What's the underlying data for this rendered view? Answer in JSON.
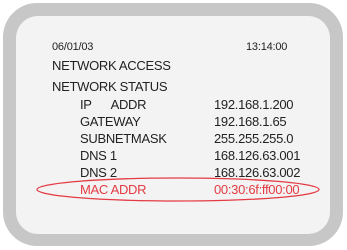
{
  "header": {
    "date": "06/01/03",
    "time": "13:14:00"
  },
  "menu": {
    "items": [
      "NETWORK ACCESS",
      "NETWORK STATUS"
    ]
  },
  "status": {
    "rows": [
      {
        "label": "IP      ADDR",
        "value": "192.168.1.200"
      },
      {
        "label": "GATEWAY",
        "value": "192.168.1.65"
      },
      {
        "label": "SUBNETMASK",
        "value": "255.255.255.0"
      },
      {
        "label": "DNS 1",
        "value": "168.126.63.001"
      },
      {
        "label": "DNS 2",
        "value": "168.126.63.002"
      },
      {
        "label": "MAC ADDR",
        "value": "00:30:6f:ff00:00"
      }
    ]
  },
  "colors": {
    "bezel": "#c7c7c7",
    "screen": "#f3f3f3",
    "text": "#222222",
    "highlight": "#e43b43"
  }
}
